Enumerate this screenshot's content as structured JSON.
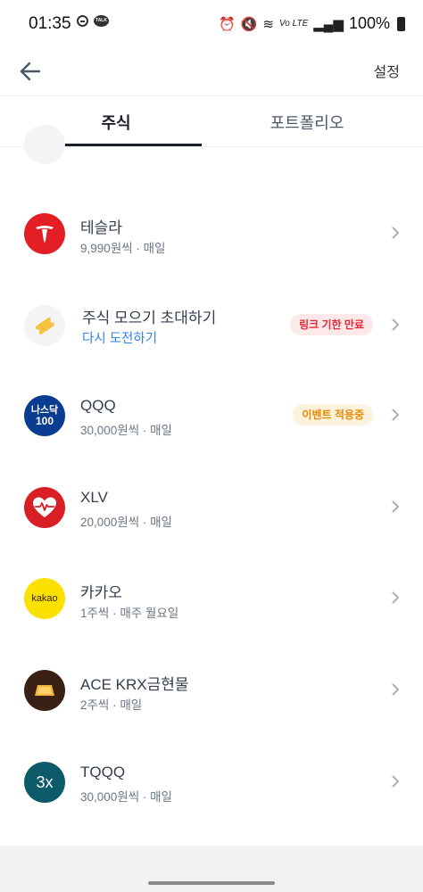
{
  "status_bar": {
    "time": "01:35",
    "battery": "100%",
    "network": "Vo LTE"
  },
  "header": {
    "settings_label": "설정"
  },
  "tabs": [
    {
      "label": "주식",
      "active": true
    },
    {
      "label": "포트폴리오",
      "active": false
    }
  ],
  "items": [
    {
      "title": "테슬라",
      "subtitle": "9,990원씩 · 매일",
      "logo": "tesla-logo",
      "logo_color": "#e31e24"
    },
    {
      "title": "주식 모으기 초대하기",
      "subtitle": "다시 도전하기",
      "badge": "링크 기한 만료",
      "logo": "ticket-icon",
      "logo_color": "#f2f4f6"
    },
    {
      "title": "QQQ",
      "subtitle": "30,000원씩 · 매일",
      "badge": "이벤트 적용중",
      "logo_text_top": "나스닥",
      "logo_text_bottom": "100",
      "logo_color": "#0a3d91"
    },
    {
      "title": "XLV",
      "subtitle": "20,000원씩 · 매일",
      "logo": "heart-pulse-icon",
      "logo_color": "#d91f26"
    },
    {
      "title": "카카오",
      "subtitle": "1주씩 · 매주 월요일",
      "logo_text": "kakao",
      "logo_color": "#fae100"
    },
    {
      "title": "ACE KRX금현물",
      "subtitle": "2주씩 · 매일",
      "logo": "gold-bar-icon",
      "logo_color": "#3b2115"
    },
    {
      "title": "TQQQ",
      "subtitle": "30,000원씩 · 매일",
      "logo_text": "3x",
      "logo_color": "#0d5a6b"
    }
  ]
}
